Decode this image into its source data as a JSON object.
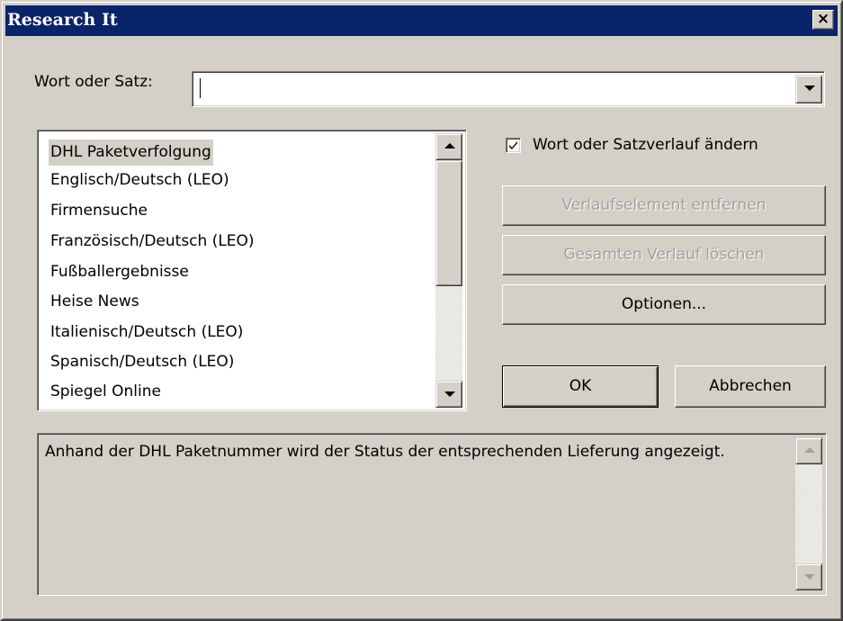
{
  "window": {
    "title": "Research It",
    "close_glyph": "×"
  },
  "search": {
    "label": "Wort oder Satz:",
    "value": ""
  },
  "list": {
    "items": [
      "DHL Paketverfolgung",
      "Englisch/Deutsch (LEO)",
      "Firmensuche",
      "Französisch/Deutsch (LEO)",
      "Fußballergebnisse",
      "Heise News",
      "Italienisch/Deutsch (LEO)",
      "Spanisch/Deutsch (LEO)",
      "Spiegel Online"
    ],
    "selected_index": 0
  },
  "options": {
    "history_checkbox_label": "Wort oder Satzverlauf ändern",
    "history_checked": true,
    "remove_item_label": "Verlaufselement entfernen",
    "clear_history_label": "Gesamten Verlauf löschen",
    "options_label": "Optionen..."
  },
  "actions": {
    "ok_label": "OK",
    "cancel_label": "Abbrechen"
  },
  "description": {
    "text": "Anhand der DHL Paketnummer wird der Status der entsprechenden Lieferung angezeigt."
  }
}
